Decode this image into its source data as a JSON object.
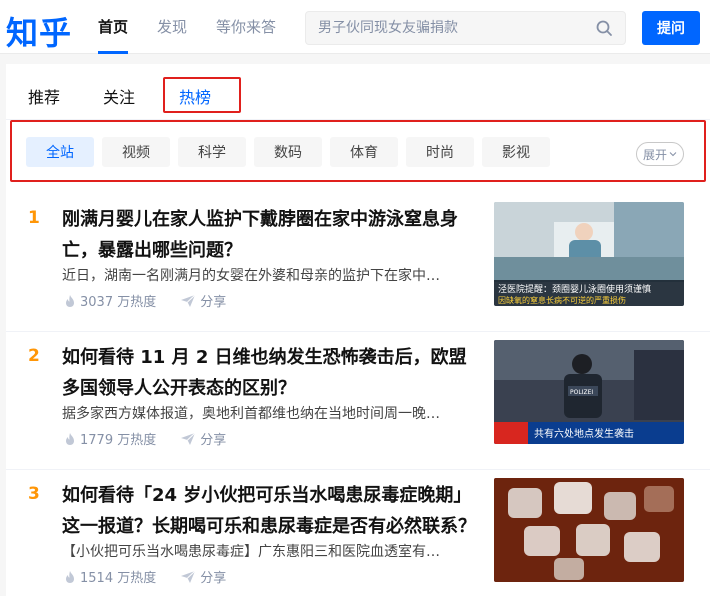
{
  "header": {
    "logo": "知乎",
    "nav": [
      "首页",
      "发现",
      "等你来答"
    ],
    "search_placeholder": "男子伙同现女友骗捐款",
    "ask_label": "提问"
  },
  "tabs": [
    "推荐",
    "关注",
    "热榜"
  ],
  "filters": [
    "全站",
    "视频",
    "科学",
    "数码",
    "体育",
    "时尚",
    "影视"
  ],
  "expand_label": "展开",
  "items": [
    {
      "rank": "1",
      "title": "刚满月婴儿在家人监护下戴脖圈在家中游泳窒息身亡，暴露出哪些问题？",
      "excerpt": "近日，湖南一名刚满月的女婴在外婆和母亲的监护下在家中…",
      "heat": "3037 万热度",
      "share": "分享",
      "thumb_caption": "泾医院提醒：颈圈婴儿泳圈使用须谨慎 因缺氧的窒息长病不可逆的严重损伤"
    },
    {
      "rank": "2",
      "title": "如何看待 11 月 2 日维也纳发生恐怖袭击后，欧盟多国领导人公开表态的区别？",
      "excerpt": "据多家西方媒体报道，奥地利首都维也纳在当地时间周一晚…",
      "heat": "1779 万热度",
      "share": "分享",
      "thumb_caption": "共有六处地点发生袭击"
    },
    {
      "rank": "3",
      "title": "如何看待「24 岁小伙把可乐当水喝患尿毒症晚期」这一报道？长期喝可乐和患尿毒症是否有必然联系？",
      "excerpt": "【小伙把可乐当水喝患尿毒症】广东惠阳三和医院血透室有…",
      "heat": "1514 万热度",
      "share": "分享",
      "thumb_caption": ""
    }
  ]
}
